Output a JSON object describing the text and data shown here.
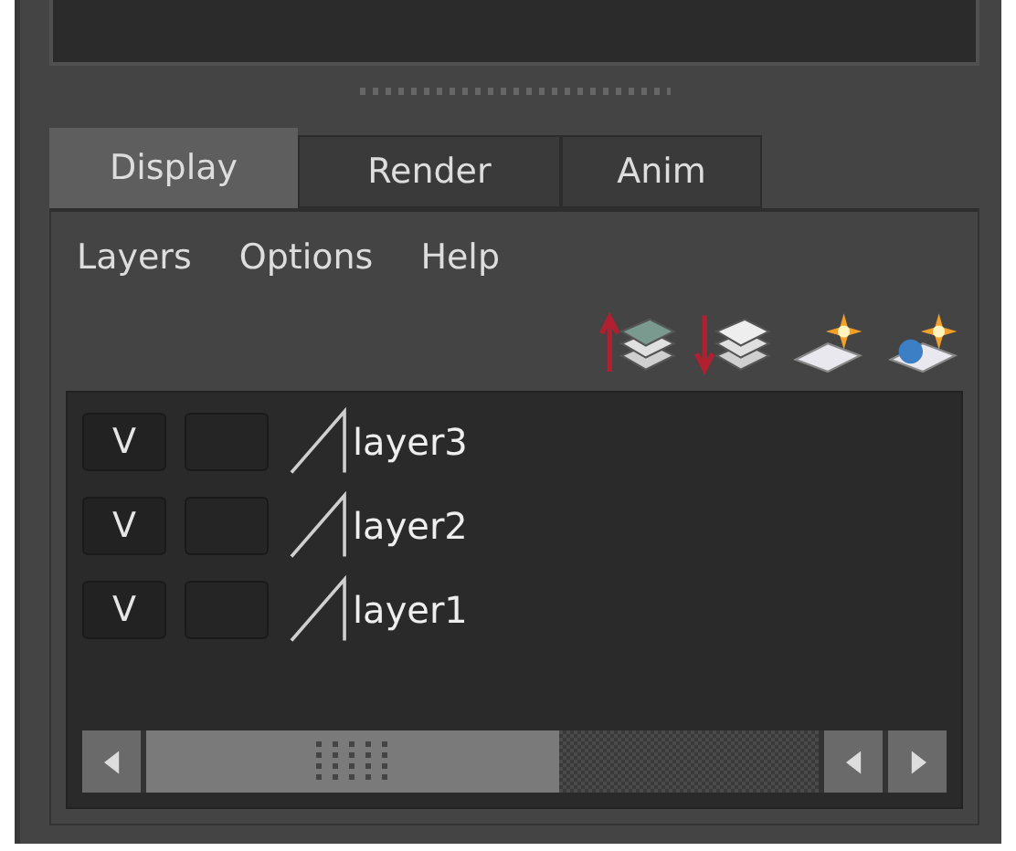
{
  "tabs": [
    {
      "label": "Display",
      "selected": true
    },
    {
      "label": "Render",
      "selected": false
    },
    {
      "label": "Anim",
      "selected": false
    }
  ],
  "menu": [
    "Layers",
    "Options",
    "Help"
  ],
  "toolbar": [
    {
      "kind": "layer-up"
    },
    {
      "kind": "layer-down"
    },
    {
      "kind": "plane-light"
    },
    {
      "kind": "sphere-light"
    }
  ],
  "layers": [
    {
      "visibility": "V",
      "name": "layer3"
    },
    {
      "visibility": "V",
      "name": "layer2"
    },
    {
      "visibility": "V",
      "name": "layer1"
    }
  ]
}
